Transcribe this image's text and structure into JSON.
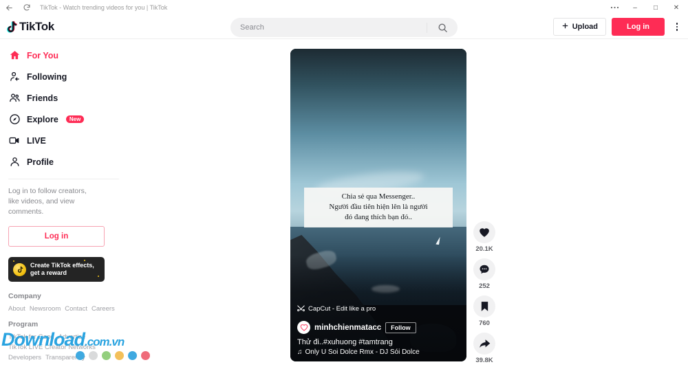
{
  "browser": {
    "title": "TikTok - Watch trending videos for you | TikTok",
    "back_icon": "back-arrow-icon",
    "reload_icon": "reload-icon",
    "more_icon": "more-horizontal-icon",
    "minimize_label": "–",
    "maximize_label": "□",
    "close_label": "✕"
  },
  "header": {
    "logo_text": "TikTok",
    "search": {
      "value": "",
      "placeholder": "Search"
    },
    "upload_label": "Upload",
    "login_label": "Log in"
  },
  "sidebar": {
    "items": [
      {
        "label": "For You",
        "icon": "home-icon",
        "active": true,
        "badge": ""
      },
      {
        "label": "Following",
        "icon": "following-user-icon",
        "active": false,
        "badge": ""
      },
      {
        "label": "Friends",
        "icon": "friends-icon",
        "active": false,
        "badge": ""
      },
      {
        "label": "Explore",
        "icon": "compass-icon",
        "active": false,
        "badge": "New"
      },
      {
        "label": "LIVE",
        "icon": "live-video-icon",
        "active": false,
        "badge": ""
      },
      {
        "label": "Profile",
        "icon": "profile-user-icon",
        "active": false,
        "badge": ""
      }
    ],
    "login_prompt": "Log in to follow creators, like videos, and view comments.",
    "login_button": "Log in",
    "promo": {
      "line1": "Create TikTok effects,",
      "line2": "get a reward",
      "icon": "tiktok-note-icon"
    },
    "footer": {
      "company_heading": "Company",
      "company_links": [
        "About",
        "Newsroom",
        "Contact",
        "Careers"
      ],
      "program_heading": "Program",
      "program_links": [
        "TikTok for Good",
        "Advertise"
      ],
      "program_links2": [
        "TikTok LIVE Creator Networks"
      ],
      "program_links3": [
        "Developers",
        "Transparency"
      ]
    }
  },
  "watermark": {
    "main": "Download",
    "suffix": ".com.vn",
    "dots": [
      "#3fa9e0",
      "#d9dadb",
      "#93cf7e",
      "#f3c05a",
      "#3fa9e0",
      "#ef6b7a"
    ]
  },
  "video": {
    "caption_overlay": "Chia sẻ qua Messenger..\nNgười đầu tiên hiện lên là người\nđó đang thích bạn đó..",
    "capcut_label": "CapCut - Edit like a pro",
    "author": "minhchienmatacc",
    "follow_label": "Follow",
    "description": "Thử đi..#xuhuong #tamtrang",
    "music": "Only U Soi Dolce Rmx - DJ Sói Dolce",
    "music_icon": "music-note-icon"
  },
  "actions": [
    {
      "icon": "heart-icon",
      "count": "20.1K",
      "name": "like"
    },
    {
      "icon": "comment-icon",
      "count": "252",
      "name": "comment"
    },
    {
      "icon": "bookmark-icon",
      "count": "760",
      "name": "bookmark"
    },
    {
      "icon": "share-icon",
      "count": "39.8K",
      "name": "share"
    }
  ],
  "colors": {
    "accent": "#fe2c55",
    "text": "#161823",
    "muted": "#87888d"
  }
}
